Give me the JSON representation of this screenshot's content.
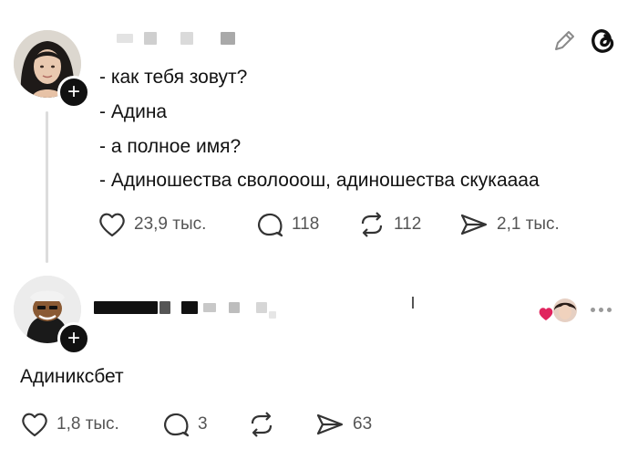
{
  "post": {
    "author_avatar": "woman-avatar",
    "lines": [
      "- как тебя зовут?",
      "- Адина",
      "- а полное имя?",
      "- Адиношества сволооош, адиношества скукаааа"
    ],
    "actions": {
      "likes": "23,9 тыс.",
      "replies": "118",
      "reposts": "112",
      "shares": "2,1 тыс."
    }
  },
  "reply": {
    "author_avatar": "cartoon-character-avatar",
    "text": "Адиниксбет",
    "actions": {
      "likes": "1,8 тыс.",
      "replies": "3",
      "shares": "63"
    }
  },
  "icons": {
    "edit": "pencil-icon",
    "app_logo": "threads-logo-icon",
    "like": "heart-icon",
    "reply": "comment-bubble-icon",
    "repost": "repost-icon",
    "share": "share-arrow-icon",
    "more": "more-dots-icon",
    "liked_by_author": "liked-by-author-icon"
  },
  "colors": {
    "accent_heart": "#e0245e",
    "icon_gray": "#555555",
    "thread_line": "#dcdcdc"
  }
}
